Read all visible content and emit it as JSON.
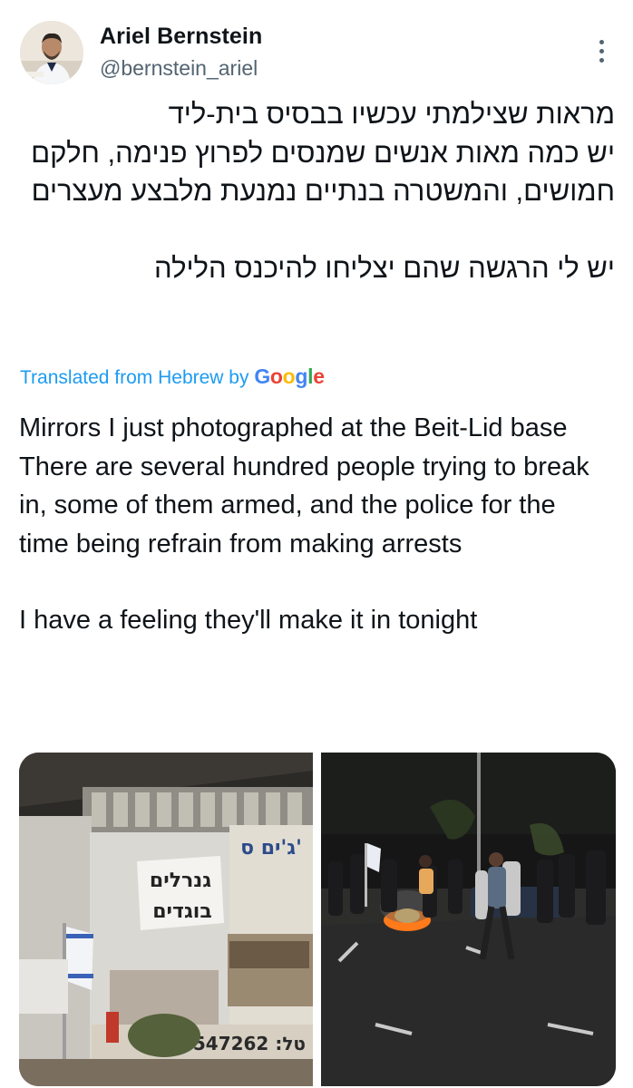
{
  "tweet": {
    "author": {
      "display_name": "Ariel Bernstein",
      "handle": "@bernstein_ariel"
    },
    "more_icon": "more-vertical-icon",
    "hebrew_text": [
      "מראות שצילמתי עכשיו בבסיס בית-ליד",
      "יש כמה מאות אנשים שמנסים לפרוץ פנימה, חלקם חמושים, והמשטרה בנתיים נמנעת מלבצע מעצרים",
      "יש לי הרגשה שהם יצליחו להיכנס הלילה"
    ],
    "translation": {
      "label": "Translated from Hebrew by",
      "provider": "Google"
    },
    "english_text": [
      "Mirrors I just photographed at the Beit-Lid base",
      "There are several hundred people trying to break in, some of them armed, and the police for the time being refrain from making arrests",
      "I have a feeling they'll make it in tonight"
    ],
    "media": {
      "photo1": {
        "sign_text_line1": "גנרלים",
        "sign_text_line2": "בוגדים",
        "banner_text": "ג'ים ס'",
        "phone_text": "050-7547262 :טל"
      }
    }
  }
}
